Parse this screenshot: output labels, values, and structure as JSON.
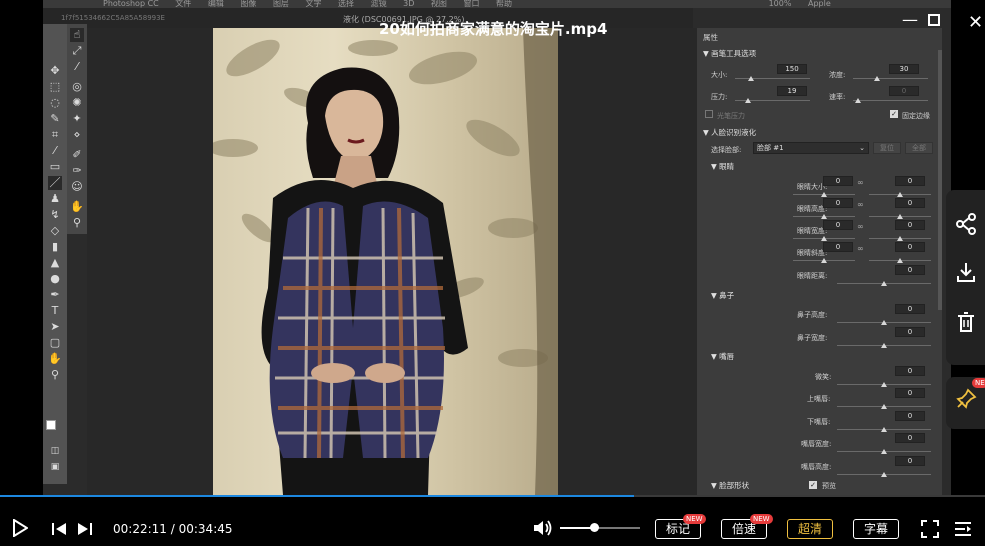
{
  "video": {
    "title": "20如何拍商家满意的淘宝片.mp4",
    "progress_fraction": 0.644,
    "volume_fraction": 0.42
  },
  "photoshop": {
    "menubar": [
      "Photoshop CC",
      "文件",
      "编辑",
      "图像",
      "图层",
      "文字",
      "选择",
      "滤镜",
      "3D",
      "视图",
      "窗口",
      "帮助"
    ],
    "menubar_right": [
      "100%",
      "Apple"
    ],
    "doc_tab": "1f7f51534662C5A85A58993E",
    "doc_name": "液化 (DSC00691.JPG @ 27.2%)"
  },
  "panel": {
    "title": "属性",
    "brush_section": "画笔工具选项",
    "size_label": "大小:",
    "size_value": "150",
    "density_label": "浓度:",
    "density_value": "30",
    "pressure_label": "压力:",
    "pressure_value": "19",
    "rate_label": "速率:",
    "rate_value": "0",
    "stylus_label": "光笔压力",
    "pin_edges_label": "固定边缘",
    "face_section": "人脸识别液化",
    "select_face_label": "选择脸部:",
    "select_face_value": "脸部 #1",
    "reset_label": "复位",
    "all_label": "全部",
    "eyes_section": "眼睛",
    "eye_size": "眼睛大小:",
    "eye_height": "眼睛高度:",
    "eye_width": "眼睛宽度:",
    "eye_tilt": "眼睛斜度:",
    "eye_distance": "眼睛距离:",
    "zero": "0",
    "nose_section": "鼻子",
    "nose_height": "鼻子高度:",
    "nose_width": "鼻子宽度:",
    "mouth_section": "嘴唇",
    "smile": "微笑:",
    "upper_lip": "上嘴唇:",
    "lower_lip": "下嘴唇:",
    "mouth_width": "嘴唇宽度:",
    "mouth_height": "嘴唇高度:",
    "face_shape_section": "脸部形状",
    "preview_label": "预览"
  },
  "player": {
    "time_current": "00:22:11",
    "time_sep": "/",
    "time_total": "00:34:45",
    "btn_mark": "标记",
    "btn_speed": "倍速",
    "btn_hd": "超清",
    "btn_subtitle": "字幕",
    "new_tag": "NEW",
    "side_new_tag": "NE"
  },
  "colors": {
    "progress": "#1d88e0",
    "hd_accent": "#f0c040",
    "new_badge": "#e53b3b"
  },
  "icons": {
    "play": "play-icon",
    "prev": "prev-icon",
    "next": "next-icon",
    "volume": "volume-icon",
    "fullscreen": "fullscreen-icon",
    "playlist": "playlist-icon",
    "share": "share-icon",
    "download": "download-icon",
    "delete": "trash-icon",
    "pin": "pin-icon",
    "minimize": "minimize-icon",
    "maximize": "maximize-icon",
    "close": "close-icon"
  }
}
